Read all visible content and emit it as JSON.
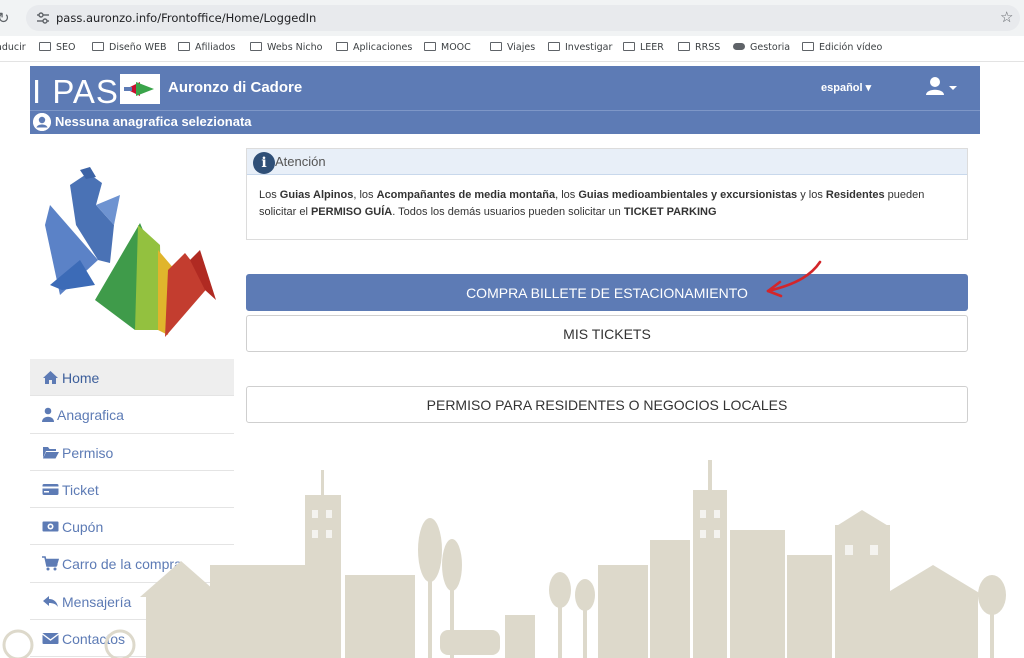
{
  "browser": {
    "url": "pass.auronzo.info/Frontoffice/Home/LoggedIn",
    "bookmarks": [
      {
        "label": "aducir",
        "icon": "none"
      },
      {
        "label": "SEO",
        "icon": "folder-icon"
      },
      {
        "label": "Diseño WEB",
        "icon": "folder-icon"
      },
      {
        "label": "Afiliados",
        "icon": "folder-icon"
      },
      {
        "label": "Webs Nicho",
        "icon": "folder-icon"
      },
      {
        "label": "Aplicaciones",
        "icon": "folder-icon"
      },
      {
        "label": "MOOC",
        "icon": "folder-icon"
      },
      {
        "label": "Viajes",
        "icon": "folder-icon"
      },
      {
        "label": "Investigar",
        "icon": "folder-icon"
      },
      {
        "label": "LEER",
        "icon": "folder-icon"
      },
      {
        "label": "RRSS",
        "icon": "folder-icon"
      },
      {
        "label": "Gestoria",
        "icon": "cloud-icon"
      },
      {
        "label": "Edición vídeo",
        "icon": "folder-icon"
      }
    ]
  },
  "header": {
    "logo_text": "I PASS",
    "site_title": "Auronzo di Cadore",
    "language": "español ▾",
    "brand_color": "#5d7bb5",
    "no_profile": "Nessuna anagrafica selezionata"
  },
  "sidebar": {
    "items": [
      {
        "label": "Home",
        "icon": "home-icon"
      },
      {
        "label": "Anagrafica",
        "icon": "user-icon"
      },
      {
        "label": "Permiso",
        "icon": "folder-open-icon"
      },
      {
        "label": "Ticket",
        "icon": "credit-card-icon"
      },
      {
        "label": "Cupón",
        "icon": "money-icon"
      },
      {
        "label": "Carro de la compra",
        "icon": "cart-icon"
      },
      {
        "label": "Mensajería",
        "icon": "share-icon"
      },
      {
        "label": "Contactos",
        "icon": "envelope-icon"
      }
    ]
  },
  "attention": {
    "title": "Atención",
    "p1": "Los ",
    "b1": "Guias Alpinos",
    "p2": ", los ",
    "b2": "Acompañantes de media montaña",
    "p3": ", los ",
    "b3": "Guias medioambientales y excursionistas",
    "p4": " y los ",
    "b4": "Residentes",
    "p5": " pueden solicitar el ",
    "b5": "PERMISO GUÍA",
    "p6": ". Todos los demás usuarios pueden solicitar un ",
    "b6": "TICKET PARKING"
  },
  "buttons": {
    "buy_parking": "COMPRA BILLETE DE ESTACIONAMIENTO",
    "my_tickets": "MIS TICKETS",
    "resident_permit": "PERMISO PARA RESIDENTES O NEGOCIOS LOCALES"
  },
  "colors": {
    "primary": "#5d7bb5",
    "arrow": "#d3262a",
    "city": "#ddd9cb"
  }
}
